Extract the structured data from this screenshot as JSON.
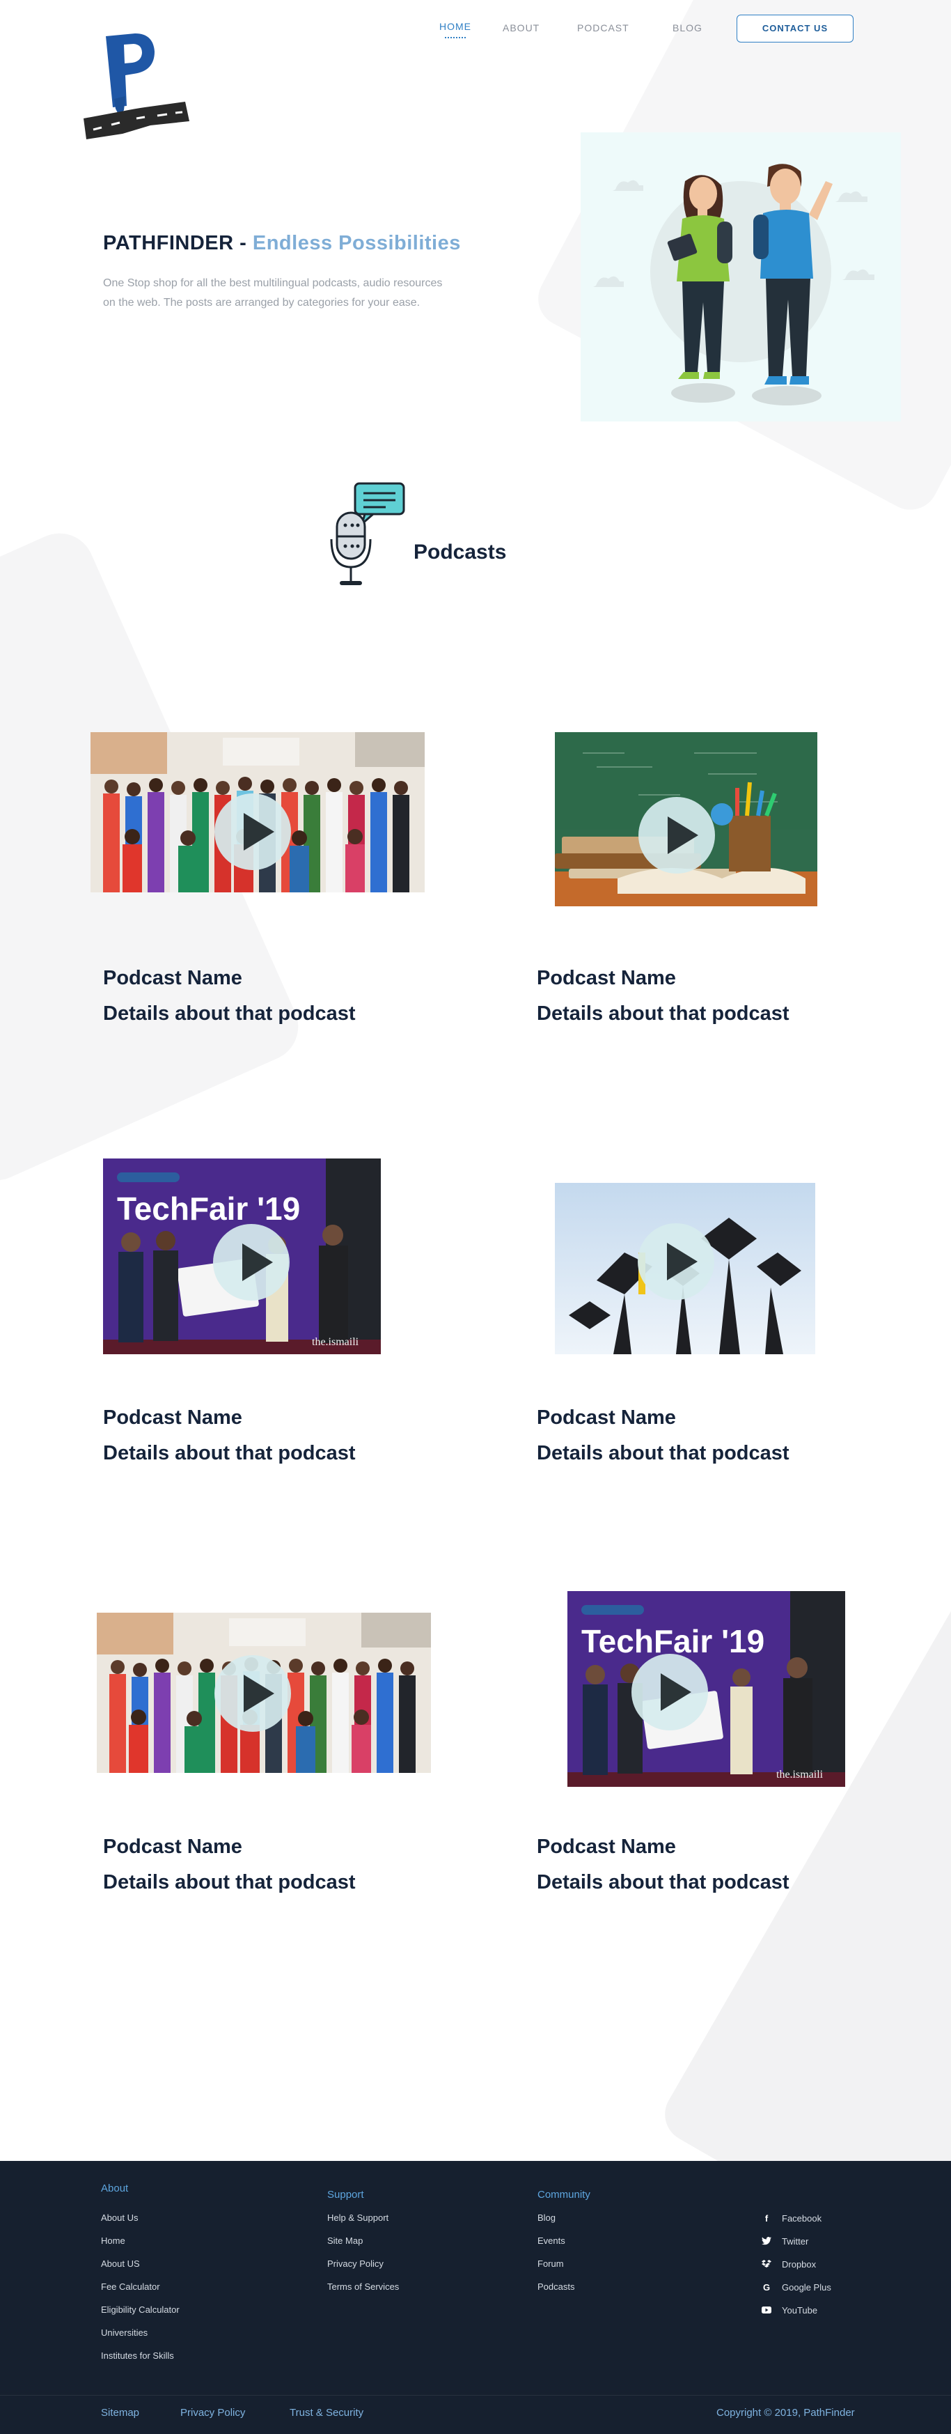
{
  "nav": {
    "home": "HOME",
    "about": "ABOUT",
    "podcast": "PODCAST",
    "blog": "BLOG",
    "contact": "CONTACT US"
  },
  "hero": {
    "title": "PATHFINDER -",
    "title_accent": "Endless Possibilities",
    "desc_line1": "One Stop shop for all the best multilingual  podcasts, audio resources",
    "desc_line2": "on the web. The posts are arranged by categories for your ease."
  },
  "section": {
    "title": "Podcasts"
  },
  "podcasts": [
    {
      "name": "Podcast Name",
      "details": "Details about that podcast",
      "image": "group-photo"
    },
    {
      "name": "Podcast Name",
      "details": "Details about that podcast",
      "image": "books-chalkboard"
    },
    {
      "name": "Podcast Name",
      "details": "Details about that podcast",
      "image": "techfair-19"
    },
    {
      "name": "Podcast Name",
      "details": "Details about that podcast",
      "image": "graduation-caps"
    },
    {
      "name": "Podcast Name",
      "details": "Details about that podcast",
      "image": "group-photo"
    },
    {
      "name": "Podcast Name",
      "details": "Details about that podcast",
      "image": "techfair-19"
    }
  ],
  "thumb_text": {
    "techfair": "TechFair '19",
    "watermark": "the.ismaili"
  },
  "footer": {
    "about": {
      "title": "About",
      "links": [
        "About Us",
        "Home",
        "About US",
        "Fee Calculator",
        "Eligibility Calculator",
        "Universities",
        "Institutes for Skills"
      ]
    },
    "support": {
      "title": "Support",
      "links": [
        "Help & Support",
        "Site Map",
        "Privacy Policy",
        "Terms of Services"
      ]
    },
    "community": {
      "title": "Community",
      "links": [
        "Blog",
        "Events",
        "Forum",
        "Podcasts"
      ]
    },
    "social": [
      {
        "label": "Facebook",
        "icon": "facebook-icon"
      },
      {
        "label": "Twitter",
        "icon": "twitter-icon"
      },
      {
        "label": "Dropbox",
        "icon": "dropbox-icon"
      },
      {
        "label": "Google Plus",
        "icon": "google-plus-icon"
      },
      {
        "label": "YouTube",
        "icon": "youtube-icon"
      }
    ],
    "bottom": {
      "sitemap": "Sitemap",
      "privacy": "Privacy Policy",
      "trust": "Trust & Security",
      "copyright": "Copyright © 2019, PathFinder"
    }
  },
  "colors": {
    "accent": "#2f7fc4",
    "title_accent": "#7fadd6",
    "footer_bg": "#16202f",
    "footer_heading": "#5ea6df",
    "text_dark": "#15233a"
  }
}
